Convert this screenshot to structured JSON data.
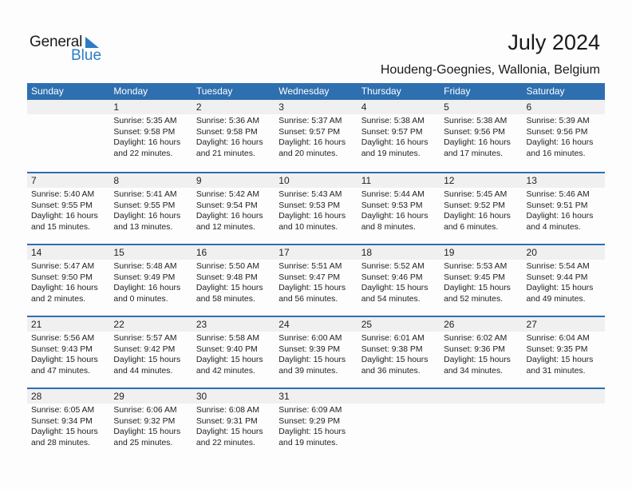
{
  "brand": {
    "line1": "General",
    "line2": "Blue",
    "accent_color": "#2c7bc4"
  },
  "header": {
    "title": "July 2024",
    "location": "Houdeng-Goegnies, Wallonia, Belgium"
  },
  "weekdays": [
    "Sunday",
    "Monday",
    "Tuesday",
    "Wednesday",
    "Thursday",
    "Friday",
    "Saturday"
  ],
  "theme": {
    "header_bg": "#2e6fb0",
    "daynum_bg": "#f0f0f0"
  },
  "weeks": [
    [
      null,
      {
        "day": "1",
        "sunrise": "Sunrise: 5:35 AM",
        "sunset": "Sunset: 9:58 PM",
        "daylight1": "Daylight: 16 hours",
        "daylight2": "and 22 minutes."
      },
      {
        "day": "2",
        "sunrise": "Sunrise: 5:36 AM",
        "sunset": "Sunset: 9:58 PM",
        "daylight1": "Daylight: 16 hours",
        "daylight2": "and 21 minutes."
      },
      {
        "day": "3",
        "sunrise": "Sunrise: 5:37 AM",
        "sunset": "Sunset: 9:57 PM",
        "daylight1": "Daylight: 16 hours",
        "daylight2": "and 20 minutes."
      },
      {
        "day": "4",
        "sunrise": "Sunrise: 5:38 AM",
        "sunset": "Sunset: 9:57 PM",
        "daylight1": "Daylight: 16 hours",
        "daylight2": "and 19 minutes."
      },
      {
        "day": "5",
        "sunrise": "Sunrise: 5:38 AM",
        "sunset": "Sunset: 9:56 PM",
        "daylight1": "Daylight: 16 hours",
        "daylight2": "and 17 minutes."
      },
      {
        "day": "6",
        "sunrise": "Sunrise: 5:39 AM",
        "sunset": "Sunset: 9:56 PM",
        "daylight1": "Daylight: 16 hours",
        "daylight2": "and 16 minutes."
      }
    ],
    [
      {
        "day": "7",
        "sunrise": "Sunrise: 5:40 AM",
        "sunset": "Sunset: 9:55 PM",
        "daylight1": "Daylight: 16 hours",
        "daylight2": "and 15 minutes."
      },
      {
        "day": "8",
        "sunrise": "Sunrise: 5:41 AM",
        "sunset": "Sunset: 9:55 PM",
        "daylight1": "Daylight: 16 hours",
        "daylight2": "and 13 minutes."
      },
      {
        "day": "9",
        "sunrise": "Sunrise: 5:42 AM",
        "sunset": "Sunset: 9:54 PM",
        "daylight1": "Daylight: 16 hours",
        "daylight2": "and 12 minutes."
      },
      {
        "day": "10",
        "sunrise": "Sunrise: 5:43 AM",
        "sunset": "Sunset: 9:53 PM",
        "daylight1": "Daylight: 16 hours",
        "daylight2": "and 10 minutes."
      },
      {
        "day": "11",
        "sunrise": "Sunrise: 5:44 AM",
        "sunset": "Sunset: 9:53 PM",
        "daylight1": "Daylight: 16 hours",
        "daylight2": "and 8 minutes."
      },
      {
        "day": "12",
        "sunrise": "Sunrise: 5:45 AM",
        "sunset": "Sunset: 9:52 PM",
        "daylight1": "Daylight: 16 hours",
        "daylight2": "and 6 minutes."
      },
      {
        "day": "13",
        "sunrise": "Sunrise: 5:46 AM",
        "sunset": "Sunset: 9:51 PM",
        "daylight1": "Daylight: 16 hours",
        "daylight2": "and 4 minutes."
      }
    ],
    [
      {
        "day": "14",
        "sunrise": "Sunrise: 5:47 AM",
        "sunset": "Sunset: 9:50 PM",
        "daylight1": "Daylight: 16 hours",
        "daylight2": "and 2 minutes."
      },
      {
        "day": "15",
        "sunrise": "Sunrise: 5:48 AM",
        "sunset": "Sunset: 9:49 PM",
        "daylight1": "Daylight: 16 hours",
        "daylight2": "and 0 minutes."
      },
      {
        "day": "16",
        "sunrise": "Sunrise: 5:50 AM",
        "sunset": "Sunset: 9:48 PM",
        "daylight1": "Daylight: 15 hours",
        "daylight2": "and 58 minutes."
      },
      {
        "day": "17",
        "sunrise": "Sunrise: 5:51 AM",
        "sunset": "Sunset: 9:47 PM",
        "daylight1": "Daylight: 15 hours",
        "daylight2": "and 56 minutes."
      },
      {
        "day": "18",
        "sunrise": "Sunrise: 5:52 AM",
        "sunset": "Sunset: 9:46 PM",
        "daylight1": "Daylight: 15 hours",
        "daylight2": "and 54 minutes."
      },
      {
        "day": "19",
        "sunrise": "Sunrise: 5:53 AM",
        "sunset": "Sunset: 9:45 PM",
        "daylight1": "Daylight: 15 hours",
        "daylight2": "and 52 minutes."
      },
      {
        "day": "20",
        "sunrise": "Sunrise: 5:54 AM",
        "sunset": "Sunset: 9:44 PM",
        "daylight1": "Daylight: 15 hours",
        "daylight2": "and 49 minutes."
      }
    ],
    [
      {
        "day": "21",
        "sunrise": "Sunrise: 5:56 AM",
        "sunset": "Sunset: 9:43 PM",
        "daylight1": "Daylight: 15 hours",
        "daylight2": "and 47 minutes."
      },
      {
        "day": "22",
        "sunrise": "Sunrise: 5:57 AM",
        "sunset": "Sunset: 9:42 PM",
        "daylight1": "Daylight: 15 hours",
        "daylight2": "and 44 minutes."
      },
      {
        "day": "23",
        "sunrise": "Sunrise: 5:58 AM",
        "sunset": "Sunset: 9:40 PM",
        "daylight1": "Daylight: 15 hours",
        "daylight2": "and 42 minutes."
      },
      {
        "day": "24",
        "sunrise": "Sunrise: 6:00 AM",
        "sunset": "Sunset: 9:39 PM",
        "daylight1": "Daylight: 15 hours",
        "daylight2": "and 39 minutes."
      },
      {
        "day": "25",
        "sunrise": "Sunrise: 6:01 AM",
        "sunset": "Sunset: 9:38 PM",
        "daylight1": "Daylight: 15 hours",
        "daylight2": "and 36 minutes."
      },
      {
        "day": "26",
        "sunrise": "Sunrise: 6:02 AM",
        "sunset": "Sunset: 9:36 PM",
        "daylight1": "Daylight: 15 hours",
        "daylight2": "and 34 minutes."
      },
      {
        "day": "27",
        "sunrise": "Sunrise: 6:04 AM",
        "sunset": "Sunset: 9:35 PM",
        "daylight1": "Daylight: 15 hours",
        "daylight2": "and 31 minutes."
      }
    ],
    [
      {
        "day": "28",
        "sunrise": "Sunrise: 6:05 AM",
        "sunset": "Sunset: 9:34 PM",
        "daylight1": "Daylight: 15 hours",
        "daylight2": "and 28 minutes."
      },
      {
        "day": "29",
        "sunrise": "Sunrise: 6:06 AM",
        "sunset": "Sunset: 9:32 PM",
        "daylight1": "Daylight: 15 hours",
        "daylight2": "and 25 minutes."
      },
      {
        "day": "30",
        "sunrise": "Sunrise: 6:08 AM",
        "sunset": "Sunset: 9:31 PM",
        "daylight1": "Daylight: 15 hours",
        "daylight2": "and 22 minutes."
      },
      {
        "day": "31",
        "sunrise": "Sunrise: 6:09 AM",
        "sunset": "Sunset: 9:29 PM",
        "daylight1": "Daylight: 15 hours",
        "daylight2": "and 19 minutes."
      },
      null,
      null,
      null
    ]
  ]
}
